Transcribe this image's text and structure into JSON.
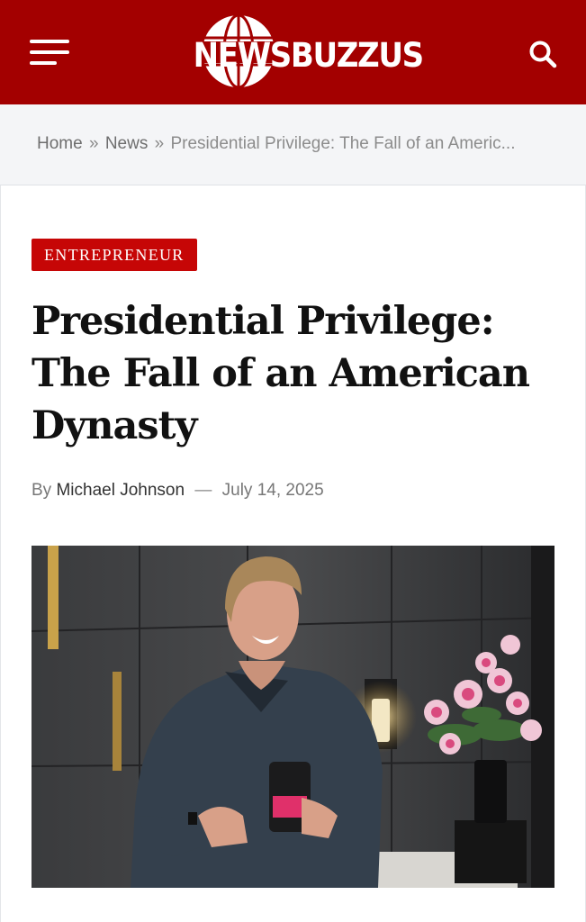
{
  "header": {
    "logo_text": "NEWSBUZZUS",
    "menu_icon": "hamburger-menu-icon",
    "search_icon": "search-icon",
    "brand_color": "#a30000"
  },
  "breadcrumb": {
    "home": "Home",
    "separator": "»",
    "section": "News",
    "current": "Presidential Privilege: The Fall of an Americ..."
  },
  "article": {
    "category": "ENTREPRENEUR",
    "category_color": "#c60606",
    "title": "Presidential Privilege: The Fall of an American Dynasty",
    "by_label": "By",
    "author": "Michael Johnson",
    "date_separator": "—",
    "date": "July 14, 2025"
  }
}
